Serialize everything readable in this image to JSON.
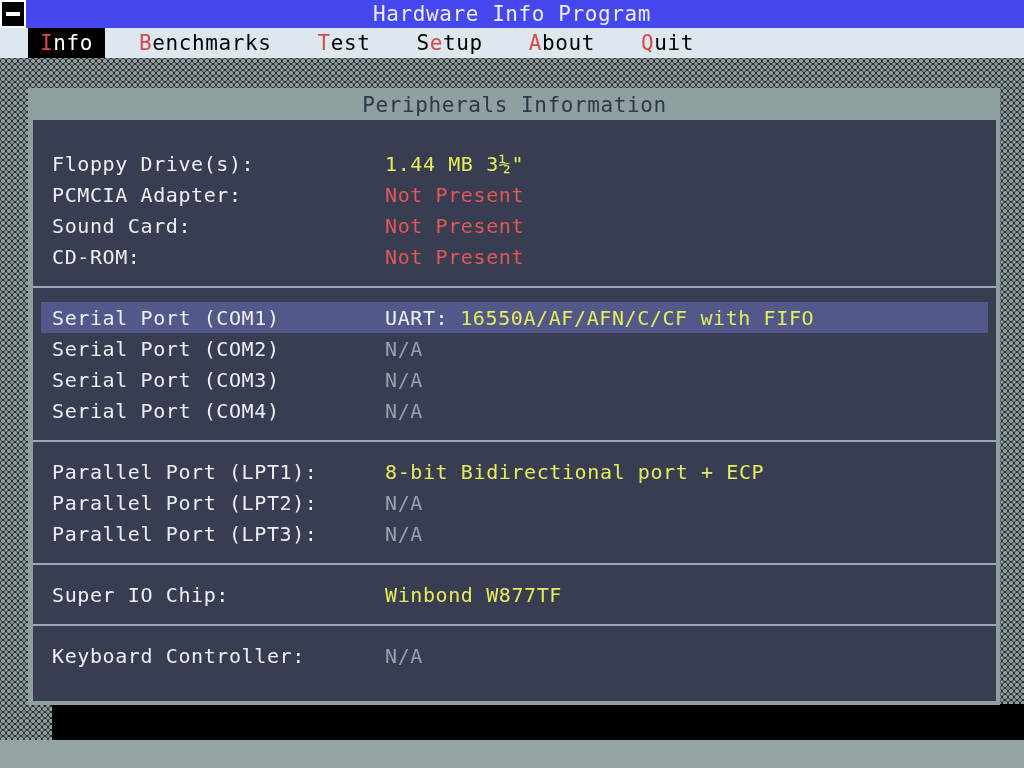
{
  "window": {
    "title": "Hardware Info Program"
  },
  "menu": [
    {
      "hotkey": "I",
      "after": "nfo",
      "selected": true
    },
    {
      "hotkey": "B",
      "after": "enchmarks",
      "selected": false
    },
    {
      "hotkey": "T",
      "after": "est",
      "selected": false
    },
    {
      "before": "S",
      "hotkey": "e",
      "after": "tup",
      "selected": false
    },
    {
      "hotkey": "A",
      "after": "bout",
      "selected": false
    },
    {
      "hotkey": "Q",
      "after": "uit",
      "selected": false
    }
  ],
  "panel": {
    "title": "Peripherals Information",
    "groups": [
      {
        "rows": [
          {
            "label": "Floppy Drive(s):",
            "value": "1.44 MB 3½\"",
            "kind": "ok",
            "selected": false
          },
          {
            "label": "PCMCIA Adapter:",
            "value": "Not Present",
            "kind": "absent",
            "selected": false
          },
          {
            "label": "Sound Card:",
            "value": "Not Present",
            "kind": "absent",
            "selected": false
          },
          {
            "label": "CD-ROM:",
            "value": "Not Present",
            "kind": "absent",
            "selected": false
          }
        ]
      },
      {
        "rows": [
          {
            "label": "Serial Port (COM1)",
            "prefix": "UART:",
            "value": "16550A/AF/AFN/C/CF with FIFO",
            "kind": "ok",
            "selected": true
          },
          {
            "label": "Serial Port (COM2)",
            "value": "N/A",
            "kind": "na",
            "selected": false
          },
          {
            "label": "Serial Port (COM3)",
            "value": "N/A",
            "kind": "na",
            "selected": false
          },
          {
            "label": "Serial Port (COM4)",
            "value": "N/A",
            "kind": "na",
            "selected": false
          }
        ]
      },
      {
        "rows": [
          {
            "label": "Parallel Port (LPT1):",
            "value": "8-bit Bidirectional port + ECP",
            "kind": "ok",
            "selected": false
          },
          {
            "label": "Parallel Port (LPT2):",
            "value": "N/A",
            "kind": "na",
            "selected": false
          },
          {
            "label": "Parallel Port (LPT3):",
            "value": "N/A",
            "kind": "na",
            "selected": false
          }
        ]
      },
      {
        "rows": [
          {
            "label": "Super IO Chip:",
            "value": "Winbond W877TF",
            "kind": "ok",
            "selected": false
          }
        ]
      },
      {
        "rows": [
          {
            "label": "Keyboard Controller:",
            "value": "N/A",
            "kind": "na",
            "selected": false
          }
        ]
      }
    ]
  }
}
